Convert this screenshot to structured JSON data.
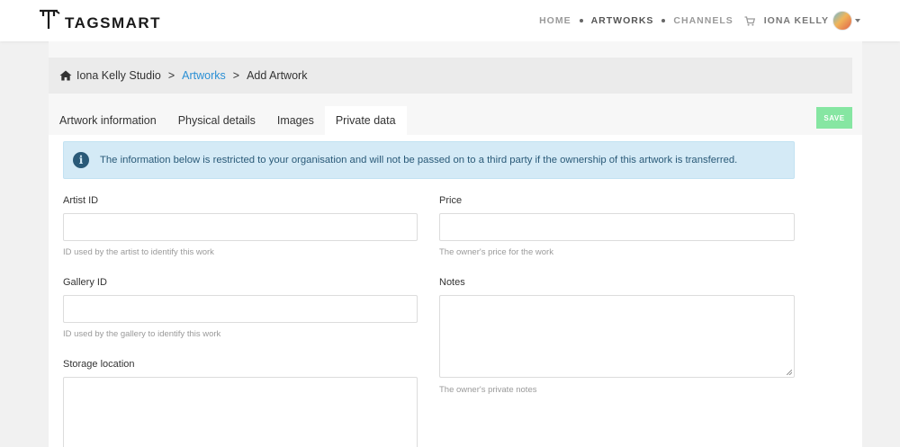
{
  "header": {
    "brand": "TAGSMART",
    "nav": [
      {
        "label": "HOME"
      },
      {
        "label": "ARTWORKS"
      },
      {
        "label": "CHANNELS"
      }
    ],
    "user_name": "IONA KELLY",
    "cart_icon": "shopping-cart-icon"
  },
  "breadcrumb": {
    "home_icon": "home-icon",
    "studio": "Iona Kelly Studio",
    "section": "Artworks",
    "current": "Add Artwork",
    "separator": ">"
  },
  "tabs": [
    {
      "label": "Artwork information"
    },
    {
      "label": "Physical details"
    },
    {
      "label": "Images"
    },
    {
      "label": "Private data"
    }
  ],
  "save_label": "SAVE",
  "alert": {
    "icon": "info-icon",
    "glyph": "i",
    "text": "The information below is restricted to your organisation and will not be passed on to a third party if the ownership of this artwork is transferred."
  },
  "form": {
    "artist_id": {
      "label": "Artist ID",
      "value": "",
      "help": "ID used by the artist to identify this work"
    },
    "gallery_id": {
      "label": "Gallery ID",
      "value": "",
      "help": "ID used by the gallery to identify this work"
    },
    "storage_location": {
      "label": "Storage location",
      "value": ""
    },
    "price": {
      "label": "Price",
      "value": "",
      "help": "The owner's price for the work"
    },
    "notes": {
      "label": "Notes",
      "value": "",
      "help": "The owner's private notes"
    }
  },
  "colors": {
    "accent_link": "#2a8fd4",
    "save_button": "#86e6a2",
    "alert_bg": "#d4eaf6",
    "alert_text": "#2a5a78"
  }
}
